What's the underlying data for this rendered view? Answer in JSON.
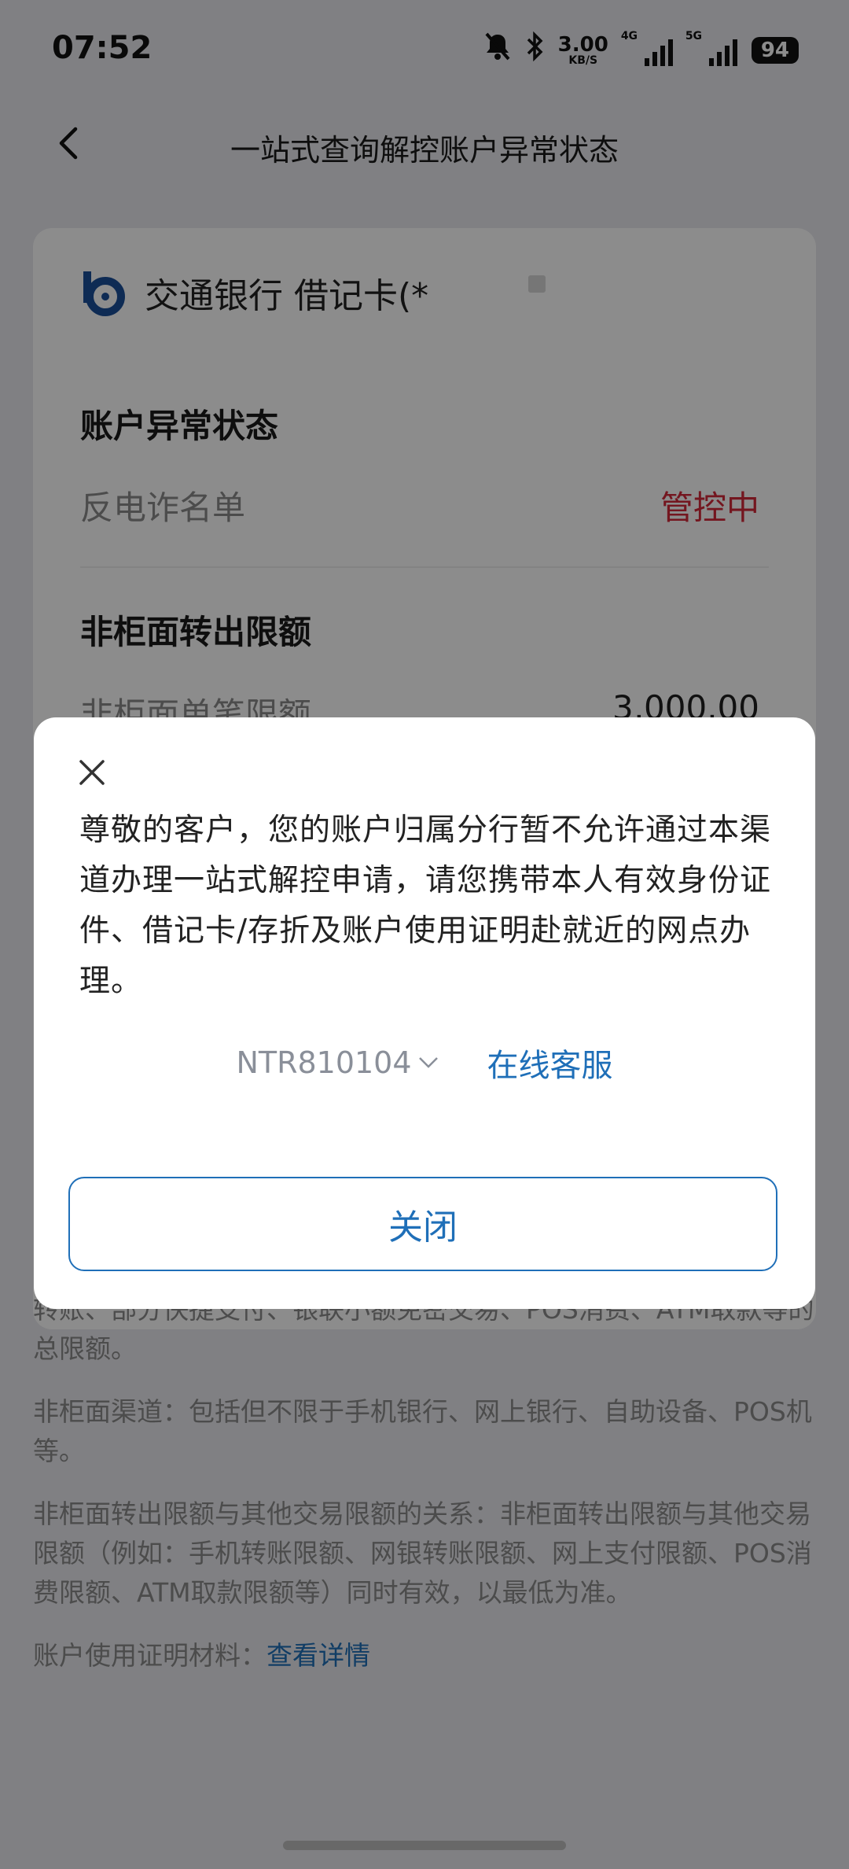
{
  "status_bar": {
    "time": "07:52",
    "net_speed_value": "3.00",
    "net_speed_unit": "KB/S",
    "signal_1_label": "4G",
    "signal_2_label": "5G",
    "battery": "94",
    "icons": [
      "mute-bell-icon",
      "bluetooth-icon"
    ]
  },
  "header": {
    "title": "一站式查询解控账户异常状态",
    "back_icon": "chevron-left-icon"
  },
  "card": {
    "bank_name": "交通银行 借记卡(*",
    "abnormal_section_title": "账户异常状态",
    "abnormal_label": "反电诈名单",
    "abnormal_value": "管控中",
    "limit_section_title": "非柜面转出限额",
    "single_limit_label": "非柜面单笔限额",
    "single_limit_value": "3,000.00"
  },
  "notes": {
    "p1": "转账、部分快捷支付、银联小额免密交易、POS消费、ATM取款等的总限额。",
    "p2": "非柜面渠道：包括但不限于手机银行、网上银行、自助设备、POS机等。",
    "p3": "非柜面转出限额与其他交易限额的关系：非柜面转出限额与其他交易限额（例如：手机转账限额、网银转账限额、网上支付限额、POS消费限额、ATM取款限额等）同时有效，以最低为准。",
    "p4_label": "账户使用证明材料：",
    "p4_link": "查看详情"
  },
  "modal": {
    "message": "尊敬的客户，您的账户归属分行暂不允许通过本渠道办理一站式解控申请，请您携带本人有效身份证件、借记卡/存折及账户使用证明赴就近的网点办理。",
    "code": "NTR810104",
    "online_service_label": "在线客服",
    "close_button_label": "关闭"
  },
  "colors": {
    "accent": "#1f6fb8",
    "alert": "#d4283a",
    "overlay": "rgba(0,0,0,0.45)"
  }
}
